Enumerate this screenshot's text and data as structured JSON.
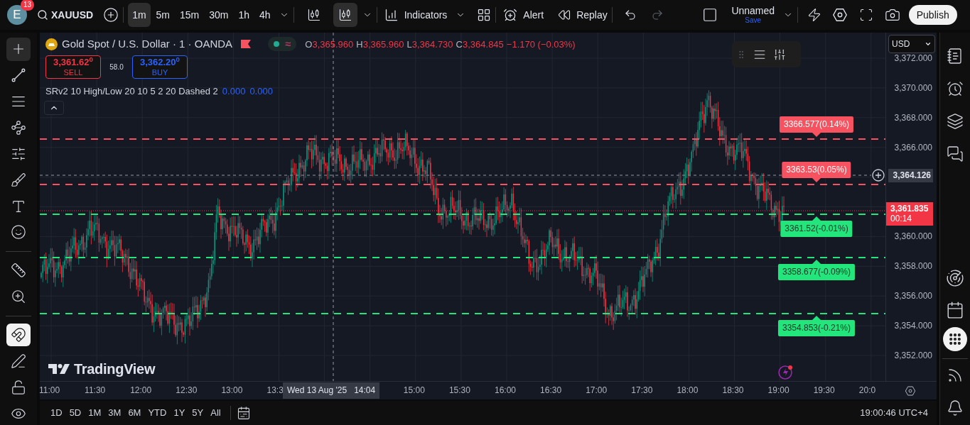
{
  "top_bar": {
    "avatar": {
      "letter": "E",
      "badge": "13"
    },
    "symbol": "XAUUSD",
    "timeframes": [
      {
        "label": "1m",
        "selected": true
      },
      {
        "label": "5m",
        "selected": false
      },
      {
        "label": "15m",
        "selected": false
      },
      {
        "label": "30m",
        "selected": false
      },
      {
        "label": "1h",
        "selected": false
      },
      {
        "label": "4h",
        "selected": false
      }
    ],
    "chart_types": [
      {
        "selected": false
      },
      {
        "selected": true
      }
    ],
    "indicators": "Indicators",
    "alert": "Alert",
    "replay": "Replay",
    "layout": {
      "name": "Unnamed",
      "save": "Save"
    },
    "publish": "Publish"
  },
  "legend": {
    "title": "Gold Spot / U.S. Dollar · 1 · OANDA",
    "pill_symbol": "≈",
    "ohlc": [
      {
        "letter": "O",
        "value": "3,365.960"
      },
      {
        "letter": "H",
        "value": "3,365.960"
      },
      {
        "letter": "L",
        "value": "3,364.730"
      },
      {
        "letter": "C",
        "value": "3,364.845"
      }
    ],
    "change": "−1.170 (−0.03%)"
  },
  "trade": {
    "sell": {
      "price": "3,361.62$^{0}$",
      "label": "SELL"
    },
    "spread": "58.0",
    "buy": {
      "price": "3,362.20$^{0}$",
      "label": "BUY"
    }
  },
  "indicator": {
    "name": "SRv2 10 High/Low 20 10 5 2 20 Dashed 2",
    "values": [
      "0.000",
      "0.000"
    ]
  },
  "levels": [
    {
      "label": "3366.577(0.14%)",
      "kind": "resistance",
      "color": "#f7525f"
    },
    {
      "label": "3363.53(0.05%)",
      "kind": "resistance",
      "color": "#f7525f"
    },
    {
      "label": "3361.52(-0.01%)",
      "kind": "support",
      "color": "#22e57c"
    },
    {
      "label": "3358.677(-0.09%)",
      "kind": "support",
      "color": "#22e57c"
    },
    {
      "label": "3354.853(-0.21%)",
      "kind": "support",
      "color": "#22e57c"
    }
  ],
  "price_axis": {
    "currency": "USD",
    "ticks": [
      "3,372.000",
      "3,370.000",
      "3,368.000",
      "3,366.000",
      "3,360.000",
      "3,358.000",
      "3,356.000",
      "3,354.000",
      "3,352.000"
    ],
    "crosshair_price": "3,364.126",
    "last_price": "3,361.835",
    "countdown": "00:14"
  },
  "time_axis": {
    "ticks": [
      "11:00",
      "11:30",
      "12:00",
      "12:30",
      "13:00",
      "13:3",
      "15:00",
      "15:30",
      "16:00",
      "16:30",
      "17:00",
      "17:30",
      "18:00",
      "18:30",
      "19:00",
      "19:30",
      "20:0"
    ],
    "crosshair_time": {
      "date": "Wed 13 Aug '25",
      "time": "14:04"
    }
  },
  "watermark": "TradingView",
  "left_toolbar": {
    "tools": [
      {
        "selected": true
      },
      {
        "selected": false
      },
      {
        "selected": false
      },
      {
        "selected": false
      },
      {
        "selected": false
      },
      {
        "selected": false
      },
      {
        "selected": false
      },
      {
        "selected": false
      },
      {
        "selected": false
      },
      {
        "selected": false
      }
    ],
    "magnet_on": true
  },
  "bottom_bar": {
    "ranges": [
      "1D",
      "5D",
      "1M",
      "3M",
      "6M",
      "YTD",
      "1Y",
      "5Y",
      "All"
    ],
    "clock": "19:00:46 UTC+4"
  }
}
